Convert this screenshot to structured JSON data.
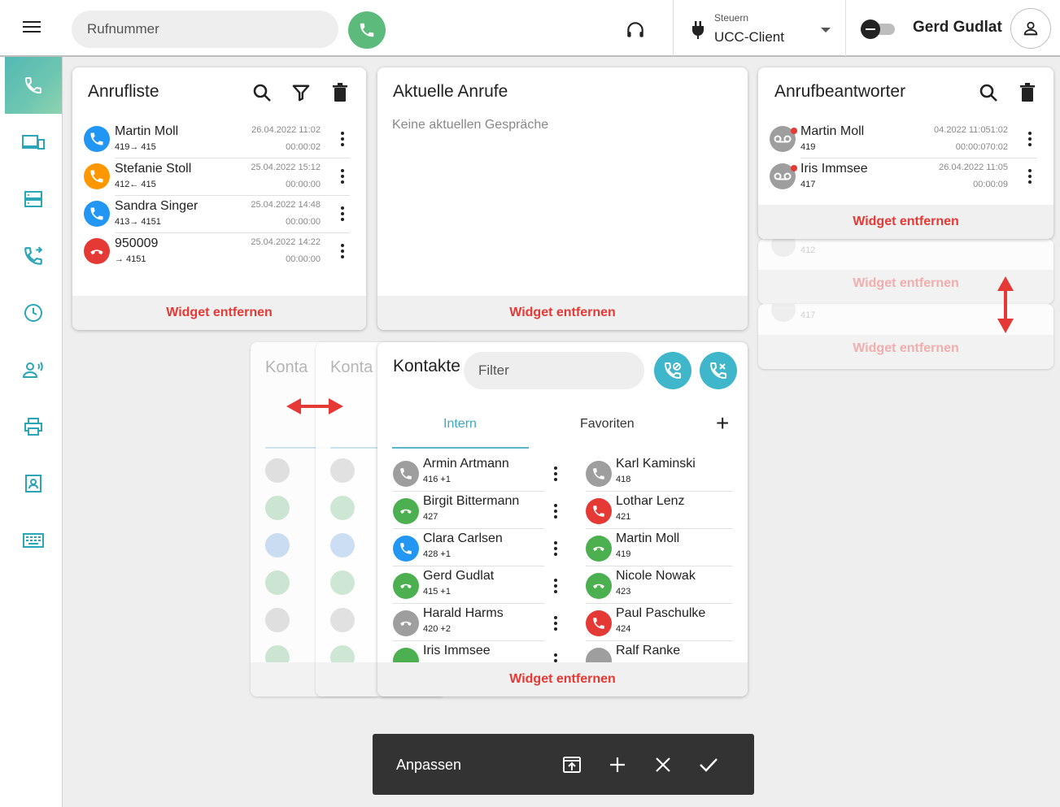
{
  "topbar": {
    "dial_placeholder": "Rufnummer",
    "steuern_label": "Steuern",
    "steuern_value": "UCC-Client",
    "username": "Gerd Gudlat"
  },
  "sidebar": {
    "items": [
      "phone-icon",
      "devices-icon",
      "server-icon",
      "call-forward-icon",
      "clock-icon",
      "presence-icon",
      "printer-icon",
      "contact-card-icon",
      "keyboard-icon"
    ]
  },
  "anrufliste": {
    "title": "Anrufliste",
    "remove": "Widget entfernen",
    "rows": [
      {
        "name": "Martin Moll",
        "sub": "419→ 415",
        "date": "26.04.2022 11:02",
        "duration": "00:00:02",
        "color": "#2196f3"
      },
      {
        "name": "Stefanie Stoll",
        "sub": "412← 415",
        "date": "25.04.2022 15:12",
        "duration": "00:00:00",
        "color": "#ff9800"
      },
      {
        "name": "Sandra Singer",
        "sub": "413→ 4151",
        "date": "25.04.2022 14:48",
        "duration": "00:00:00",
        "color": "#2196f3"
      },
      {
        "name": "950009",
        "sub": "→ 4151",
        "date": "25.04.2022 14:22",
        "duration": "00:00:00",
        "color": "#e53935"
      }
    ]
  },
  "aktuelle": {
    "title": "Aktuelle Anrufe",
    "empty": "Keine aktuellen Gespräche",
    "remove": "Widget entfernen"
  },
  "anrufbeantworter": {
    "title": "Anrufbeantworter",
    "remove": "Widget entfernen",
    "ghost_remove": "Widget entfernen",
    "ghost_sub_1": "412",
    "ghost_sub_2": "417",
    "rows": [
      {
        "name": "Martin Moll",
        "sub": "419",
        "date": "04.2022 11:051:02",
        "duration": "00:00:070:02"
      },
      {
        "name": "Iris Immsee",
        "sub": "417",
        "date": "26.04.2022 11:05",
        "duration": "00:00:09"
      }
    ]
  },
  "kontakte": {
    "title": "Kontakte",
    "ghost_title": "Konta",
    "filter_placeholder": "Filter",
    "tab_intern": "Intern",
    "tab_favoriten": "Favoriten",
    "add": "+",
    "remove": "Widget entfernen",
    "intern": [
      {
        "name": "Armin Artmann",
        "sub": "416 +1",
        "color": "#9e9e9e"
      },
      {
        "name": "Birgit Bittermann",
        "sub": "427",
        "color": "#4caf50"
      },
      {
        "name": "Clara Carlsen",
        "sub": "428 +1",
        "color": "#2196f3"
      },
      {
        "name": "Gerd Gudlat",
        "sub": "415 +1",
        "color": "#4caf50"
      },
      {
        "name": "Harald Harms",
        "sub": "420 +2",
        "color": "#9e9e9e"
      },
      {
        "name": "Iris Immsee",
        "sub": "",
        "color": "#4caf50"
      }
    ],
    "favoriten": [
      {
        "name": "Karl Kaminski",
        "sub": "418",
        "color": "#9e9e9e"
      },
      {
        "name": "Lothar Lenz",
        "sub": "421",
        "color": "#e53935"
      },
      {
        "name": "Martin Moll",
        "sub": "419",
        "color": "#4caf50"
      },
      {
        "name": "Nicole Nowak",
        "sub": "423",
        "color": "#4caf50"
      },
      {
        "name": "Paul Paschulke",
        "sub": "424",
        "color": "#e53935"
      },
      {
        "name": "Ralf Ranke",
        "sub": "",
        "color": "#9e9e9e"
      }
    ]
  },
  "customize": {
    "label": "Anpassen"
  },
  "colors": {
    "accent_teal": "#3fb6c9",
    "call_green": "#5dba7d",
    "remove_red": "#e53935"
  }
}
